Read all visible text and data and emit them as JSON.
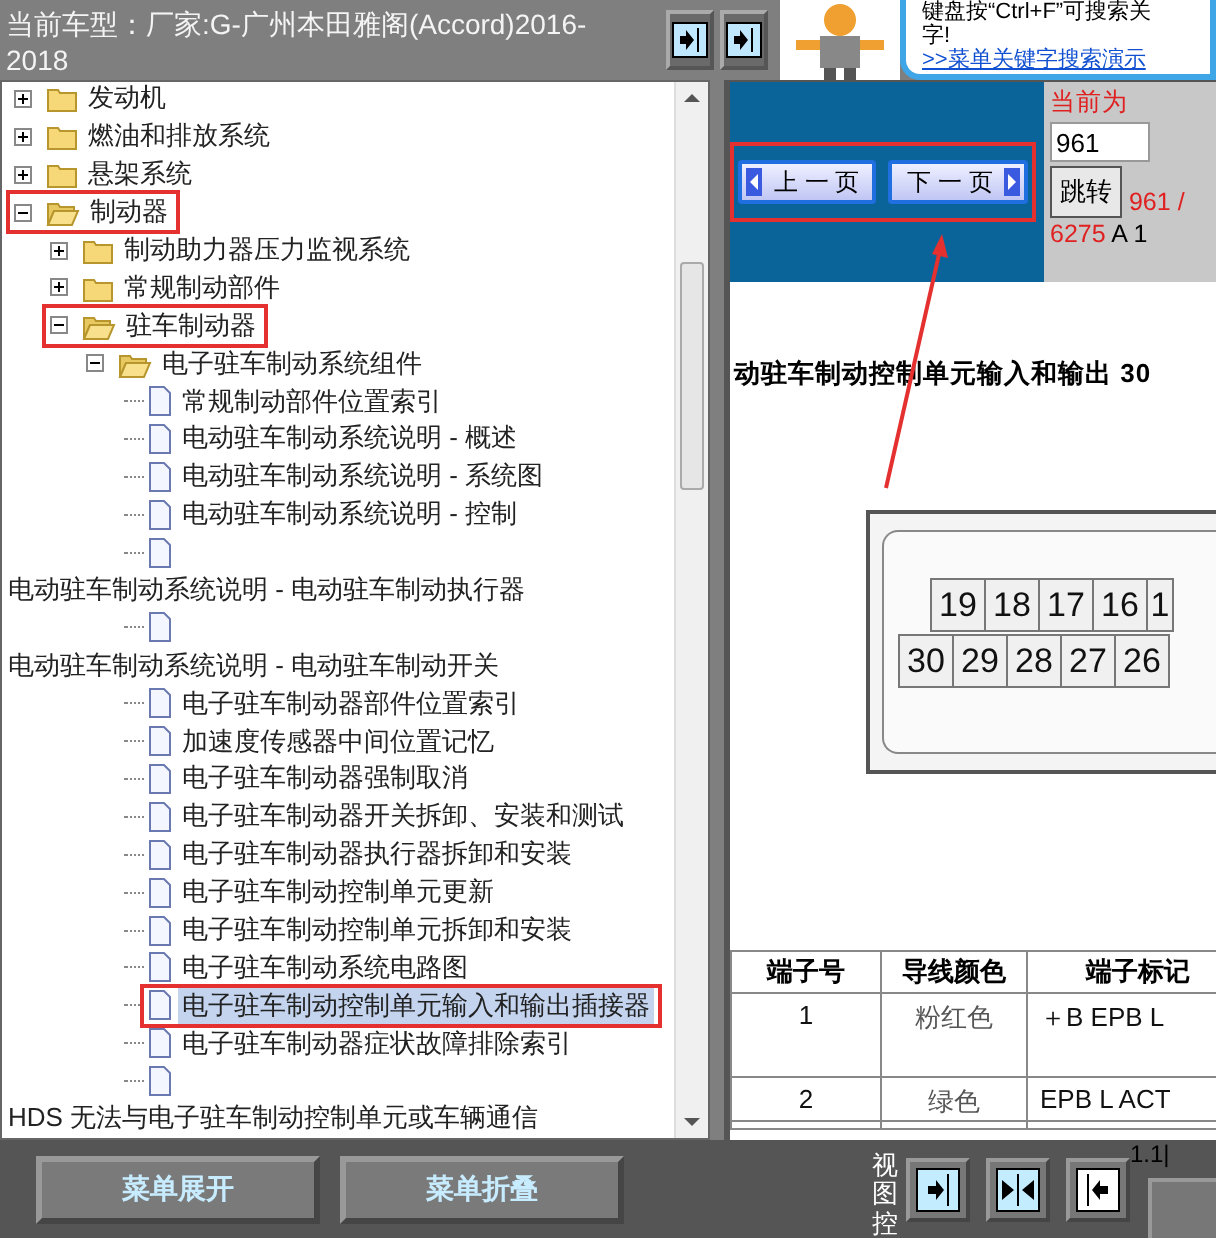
{
  "header": {
    "vehicle_label": "当前车型：厂家:G-广州本田雅阁(Accord)2016-2018"
  },
  "banner": {
    "hint": "键盘按“Ctrl+F”可搜索关",
    "hint_end": "字!",
    "link": ">>菜单关键字搜索演示"
  },
  "tree": [
    {
      "label": "发动机",
      "kind": "folder",
      "expanded": false,
      "selected": false,
      "annotated": false
    },
    {
      "label": "燃油和排放系统",
      "kind": "folder",
      "expanded": false,
      "selected": false,
      "annotated": false
    },
    {
      "label": "悬架系统",
      "kind": "folder",
      "expanded": false,
      "selected": false,
      "annotated": false
    },
    {
      "label": "制动器",
      "kind": "folder",
      "expanded": true,
      "selected": false,
      "annotated": true,
      "children": [
        {
          "label": "制动助力器压力监视系统",
          "kind": "folder",
          "expanded": false,
          "selected": false,
          "annotated": false
        },
        {
          "label": "常规制动部件",
          "kind": "folder",
          "expanded": false,
          "selected": false,
          "annotated": false
        },
        {
          "label": "驻车制动器",
          "kind": "folder",
          "expanded": true,
          "selected": false,
          "annotated": true,
          "children": [
            {
              "label": "电子驻车制动系统组件",
              "kind": "folder",
              "expanded": true,
              "selected": false,
              "annotated": false,
              "children": [
                {
                  "label": "常规制动部件位置索引",
                  "kind": "page",
                  "wrapped": false,
                  "selected": false,
                  "annotated": false
                },
                {
                  "label": "电动驻车制动系统说明 - 概述",
                  "kind": "page",
                  "wrapped": false,
                  "selected": false,
                  "annotated": false
                },
                {
                  "label": "电动驻车制动系统说明 - 系统图",
                  "kind": "page",
                  "wrapped": false,
                  "selected": false,
                  "annotated": false
                },
                {
                  "label": "电动驻车制动系统说明 - 控制",
                  "kind": "page",
                  "wrapped": false,
                  "selected": false,
                  "annotated": false
                },
                {
                  "label": "电动驻车制动系统说明 - 电动驻车制动执行器",
                  "kind": "page",
                  "wrapped": true,
                  "selected": false,
                  "annotated": false
                },
                {
                  "label": "电动驻车制动系统说明 - 电动驻车制动开关",
                  "kind": "page",
                  "wrapped": true,
                  "selected": false,
                  "annotated": false
                },
                {
                  "label": "电子驻车制动器部件位置索引",
                  "kind": "page",
                  "wrapped": false,
                  "selected": false,
                  "annotated": false
                },
                {
                  "label": "加速度传感器中间位置记忆",
                  "kind": "page",
                  "wrapped": false,
                  "selected": false,
                  "annotated": false
                },
                {
                  "label": "电子驻车制动器强制取消",
                  "kind": "page",
                  "wrapped": false,
                  "selected": false,
                  "annotated": false
                },
                {
                  "label": "电子驻车制动器开关拆卸、安装和测试",
                  "kind": "page",
                  "wrapped": false,
                  "selected": false,
                  "annotated": false
                },
                {
                  "label": "电子驻车制动器执行器拆卸和安装",
                  "kind": "page",
                  "wrapped": false,
                  "selected": false,
                  "annotated": false
                },
                {
                  "label": "电子驻车制动控制单元更新",
                  "kind": "page",
                  "wrapped": false,
                  "selected": false,
                  "annotated": false
                },
                {
                  "label": "电子驻车制动控制单元拆卸和安装",
                  "kind": "page",
                  "wrapped": false,
                  "selected": false,
                  "annotated": false
                },
                {
                  "label": "电子驻车制动系统电路图",
                  "kind": "page",
                  "wrapped": false,
                  "selected": false,
                  "annotated": false
                },
                {
                  "label": "电子驻车制动控制单元输入和输出插接器",
                  "kind": "page",
                  "wrapped": false,
                  "selected": true,
                  "annotated": true
                },
                {
                  "label": "电子驻车制动器症状故障排除索引",
                  "kind": "page",
                  "wrapped": false,
                  "selected": false,
                  "annotated": false
                },
                {
                  "label": "HDS 无法与电子驻车制动控制单元或车辆通信",
                  "kind": "page",
                  "wrapped": true,
                  "selected": false,
                  "annotated": false
                }
              ]
            }
          ]
        }
      ]
    }
  ],
  "pager": {
    "prev": "上 一 页",
    "next": "下 一 页",
    "annotated": true,
    "current_label": "当前为",
    "page_input": "961",
    "jump": "跳转",
    "position_current": "961 /",
    "position_total": "6275",
    "section": "A 1"
  },
  "document": {
    "heading": "动驻车制动控制单元输入和输出  30",
    "connector_pins": [
      [
        "19",
        "18",
        "17",
        "16",
        "1"
      ],
      [
        "30",
        "29",
        "28",
        "27",
        "26"
      ]
    ],
    "table": {
      "columns": [
        "端子号",
        "导线颜色",
        "端子标记"
      ],
      "rows": [
        [
          "1",
          "粉红色",
          "＋B EPB L"
        ],
        [
          "2",
          "绿色",
          "EPB L ACT"
        ]
      ]
    }
  },
  "bottom_bar": {
    "buttons": [
      "菜单展开",
      "菜单折叠"
    ],
    "view_label": "视图控",
    "zoom_text": "1.1|"
  }
}
